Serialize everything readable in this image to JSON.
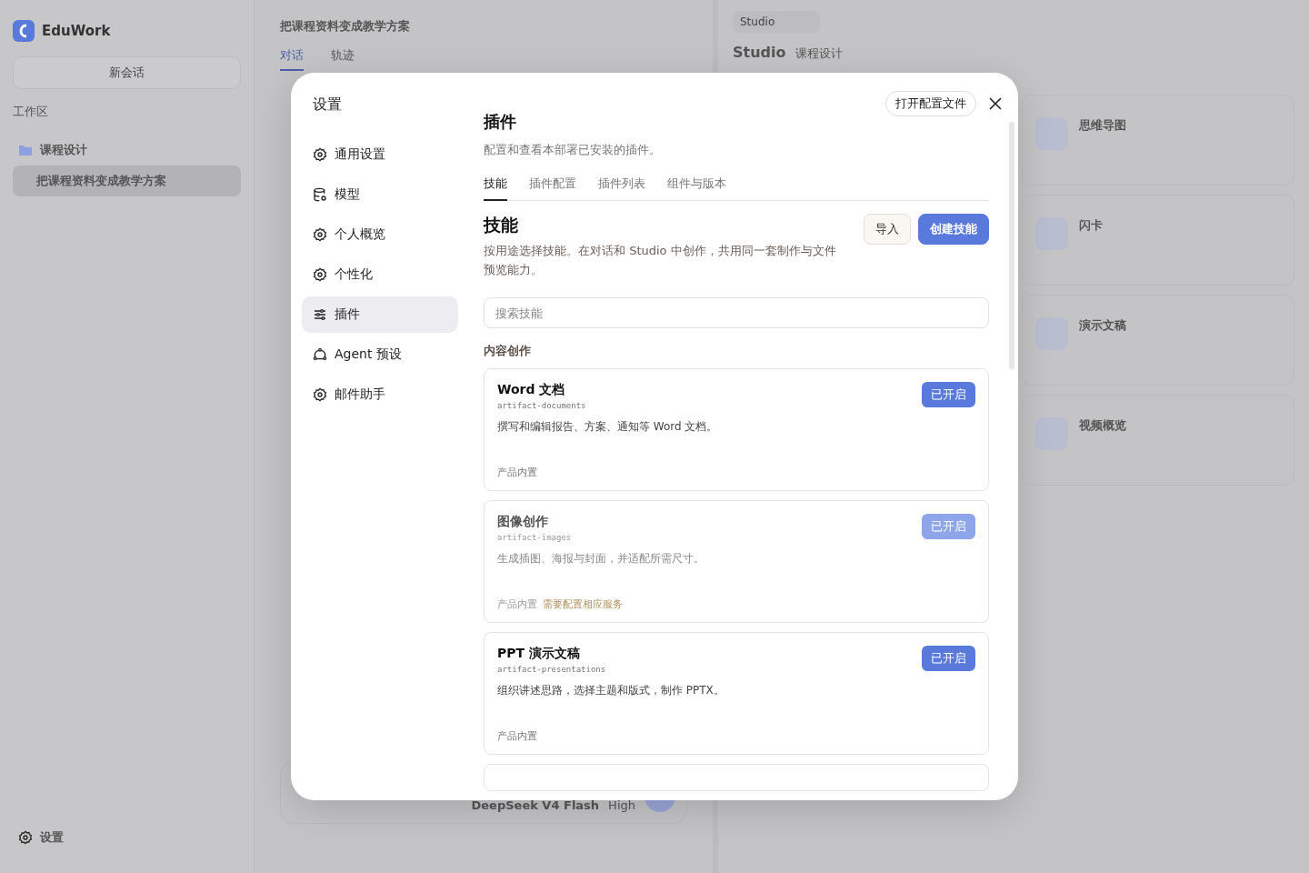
{
  "background": {
    "sidebar": {
      "brand": "EduWork",
      "new_chat": "新会话",
      "section": "工作区",
      "folders": [
        {
          "label": "课程设计",
          "children": [
            {
              "label": "把课程资料变成教学方案",
              "selected": true
            }
          ]
        }
      ],
      "settings": "设置"
    },
    "chat": {
      "title": "把课程资料变成教学方案",
      "tabs": [
        {
          "label": "对话",
          "selected": true
        },
        {
          "label": "轨迹",
          "selected": false
        }
      ],
      "model": "DeepSeek V4 Flash",
      "effort": "High"
    },
    "studio": {
      "tab": "Studio",
      "title": "Studio",
      "subtitle": "课程设计",
      "cards": [
        {
          "title": "思维导图"
        },
        {
          "title": "闪卡"
        },
        {
          "title": "演示文稿"
        },
        {
          "title": "视频概览"
        }
      ]
    }
  },
  "dialog": {
    "title": "设置",
    "open_config": "打开配置文件",
    "nav": [
      {
        "label": "通用设置",
        "kind": "gear",
        "selected": false
      },
      {
        "label": "模型",
        "kind": "database",
        "selected": false
      },
      {
        "label": "个人概览",
        "kind": "gear",
        "selected": false
      },
      {
        "label": "个性化",
        "kind": "gear",
        "selected": false
      },
      {
        "label": "插件",
        "kind": "sliders",
        "selected": true
      },
      {
        "label": "Agent 预设",
        "kind": "agent",
        "selected": false
      },
      {
        "label": "邮件助手",
        "kind": "gear",
        "selected": false
      }
    ],
    "heading": "插件",
    "description": "配置和查看本部署已安装的插件。",
    "tabs": [
      {
        "label": "技能",
        "selected": true
      },
      {
        "label": "插件配置",
        "selected": false
      },
      {
        "label": "插件列表",
        "selected": false
      },
      {
        "label": "组件与版本",
        "selected": false
      }
    ],
    "section": {
      "title": "技能",
      "description": "按用途选择技能。在对话和 Studio 中创作，共用同一套制作与文件预览能力。",
      "import": "导入",
      "create": "创建技能"
    },
    "search": {
      "placeholder": "搜索技能"
    },
    "group": "内容创作",
    "skills": [
      {
        "name": "Word 文档",
        "id": "artifact-documents",
        "description": "撰写和编辑报告、方案、通知等 Word 文档。",
        "source": "产品内置",
        "enabled_label": "已开启",
        "dimmed": false
      },
      {
        "name": "图像创作",
        "id": "artifact-images",
        "description": "生成插图、海报与封面，并适配所需尺寸。",
        "source": "产品内置",
        "note": "需要配置相应服务",
        "enabled_label": "已开启",
        "dimmed": true
      },
      {
        "name": "PPT 演示文稿",
        "id": "artifact-presentations",
        "description": "组织讲述思路，选择主题和版式，制作 PPTX。",
        "source": "产品内置",
        "enabled_label": "已开启",
        "dimmed": false
      }
    ]
  }
}
